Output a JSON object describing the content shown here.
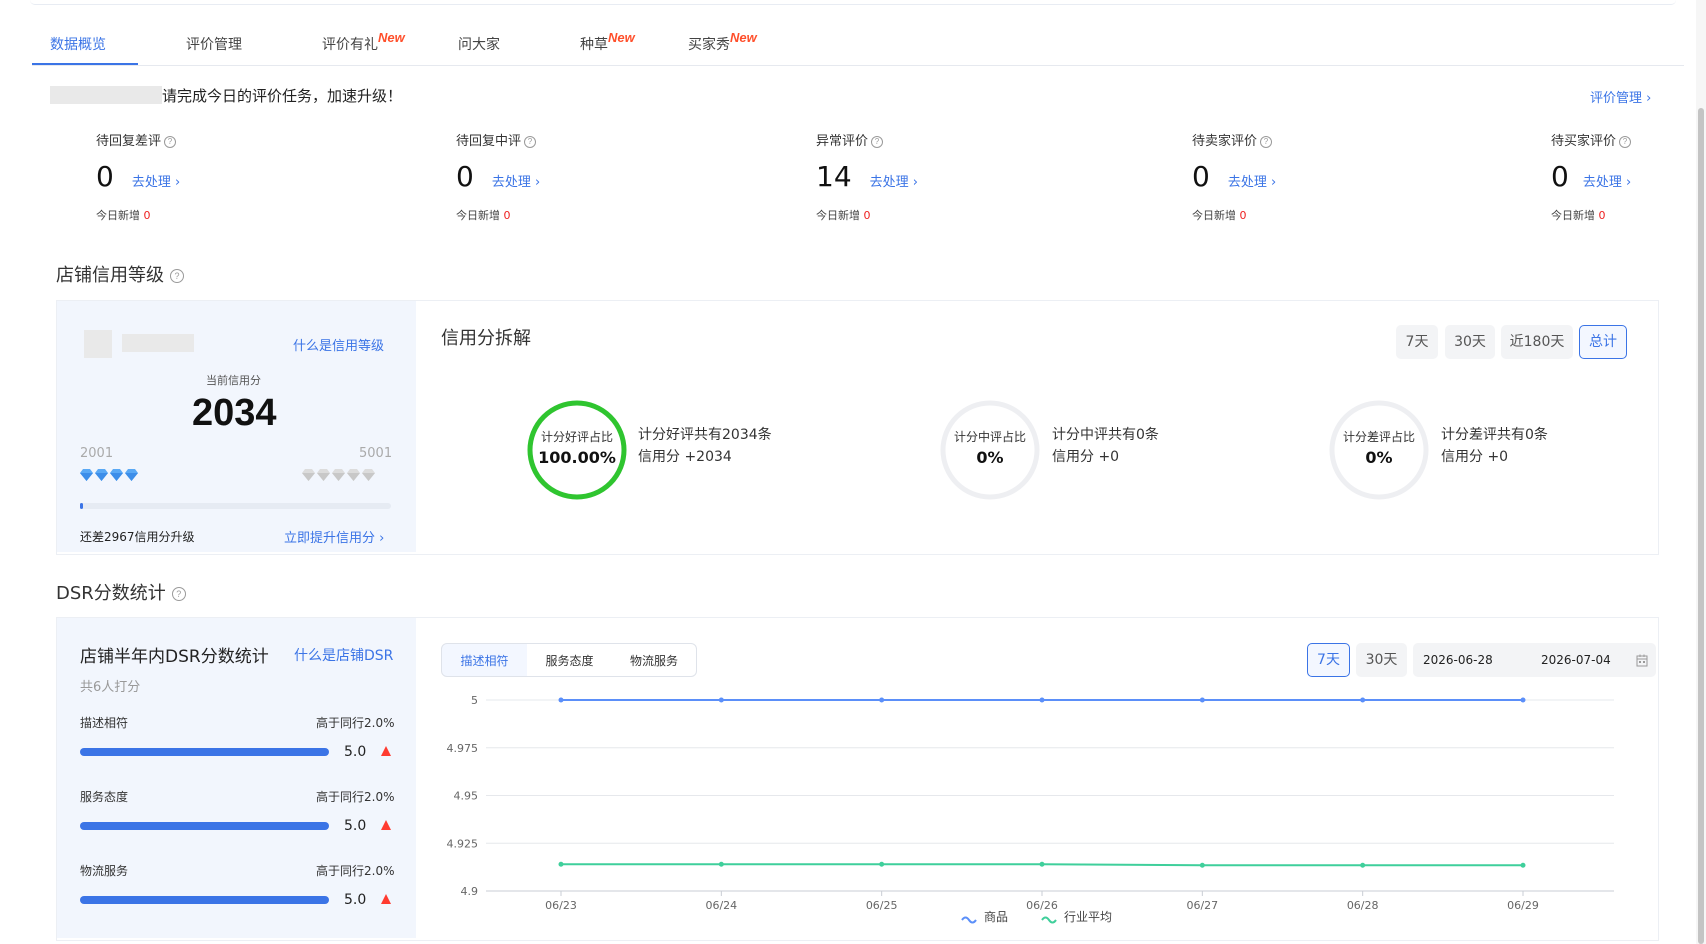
{
  "tabs": [
    {
      "label": "数据概览",
      "active": true,
      "new": false
    },
    {
      "label": "评价管理",
      "active": false,
      "new": false
    },
    {
      "label": "评价有礼",
      "active": false,
      "new": true
    },
    {
      "label": "问大家",
      "active": false,
      "new": false
    },
    {
      "label": "种草",
      "active": false,
      "new": true
    },
    {
      "label": "买家秀",
      "active": false,
      "new": true
    }
  ],
  "new_badge": "New",
  "notice": "请完成今日的评价任务，加速升级！",
  "review_manage_link": "评价管理",
  "stats": [
    {
      "label": "待回复差评",
      "value": "0",
      "action": "去处理",
      "sub_label": "今日新增",
      "sub_value": "0"
    },
    {
      "label": "待回复中评",
      "value": "0",
      "action": "去处理",
      "sub_label": "今日新增",
      "sub_value": "0"
    },
    {
      "label": "异常评价",
      "value": "14",
      "action": "去处理",
      "sub_label": "今日新增",
      "sub_value": "0"
    },
    {
      "label": "待卖家评价",
      "value": "0",
      "action": "去处理",
      "sub_label": "今日新增",
      "sub_value": "0"
    },
    {
      "label": "待买家评价",
      "value": "0",
      "action": "去处理",
      "sub_label": "今日新增",
      "sub_value": "0"
    }
  ],
  "credit": {
    "section_title": "店铺信用等级",
    "what_link": "什么是信用等级",
    "current_label": "当前信用分",
    "score": "2034",
    "range_min": "2001",
    "range_max": "5001",
    "progress_fraction": 0.011,
    "remaining_text": "还差2967信用分升级",
    "improve_link": "立即提升信用分",
    "breakdown_title": "信用分拆解",
    "period_buttons": [
      "7天",
      "30天",
      "近180天",
      "总计"
    ],
    "active_period": "总计",
    "rings": [
      {
        "label": "计分好评占比",
        "value": "100.00%",
        "fraction": 1.0,
        "color": "#2fc52f",
        "line1": "计分好评共有2034条",
        "line2": "信用分 +2034"
      },
      {
        "label": "计分中评占比",
        "value": "0%",
        "fraction": 0,
        "color": "#2fc52f",
        "line1": "计分中评共有0条",
        "line2": "信用分 +0"
      },
      {
        "label": "计分差评占比",
        "value": "0%",
        "fraction": 0,
        "color": "#2fc52f",
        "line1": "计分差评共有0条",
        "line2": "信用分 +0"
      }
    ]
  },
  "dsr": {
    "section_title": "DSR分数统计",
    "card_title": "店铺半年内DSR分数统计",
    "what_link": "什么是店铺DSR",
    "raters": "共6人打分",
    "items": [
      {
        "label": "描述相符",
        "compare": "高于同行2.0%",
        "score": "5.0",
        "fraction": 1.0
      },
      {
        "label": "服务态度",
        "compare": "高于同行2.0%",
        "score": "5.0",
        "fraction": 1.0
      },
      {
        "label": "物流服务",
        "compare": "高于同行2.0%",
        "score": "5.0",
        "fraction": 1.0
      }
    ],
    "segments": [
      "描述相符",
      "服务态度",
      "物流服务"
    ],
    "active_segment": "描述相符",
    "period_buttons": [
      "7天",
      "30天"
    ],
    "active_period": "7天",
    "date_start": "2026-06-28",
    "date_end": "2026-07-04"
  },
  "chart_data": {
    "type": "line",
    "x": [
      "06/23",
      "06/24",
      "06/25",
      "06/26",
      "06/27",
      "06/28",
      "06/29"
    ],
    "yticks": [
      "4.9",
      "4.925",
      "4.95",
      "4.975",
      "5"
    ],
    "ylim": [
      4.9,
      5.0
    ],
    "grid": true,
    "legend": "bottom",
    "series": [
      {
        "name": "商品",
        "values": [
          5,
          5,
          5,
          5,
          5,
          5,
          5
        ],
        "color": "#5b8ff9"
      },
      {
        "name": "行业平均",
        "values": [
          4.914,
          4.914,
          4.914,
          4.914,
          4.9135,
          4.9135,
          4.9135
        ],
        "color": "#3fcf9b"
      }
    ]
  },
  "colors": {
    "accent": "#3b74e6",
    "warning": "#ee2222",
    "new_badge": "#ff4f2b"
  }
}
